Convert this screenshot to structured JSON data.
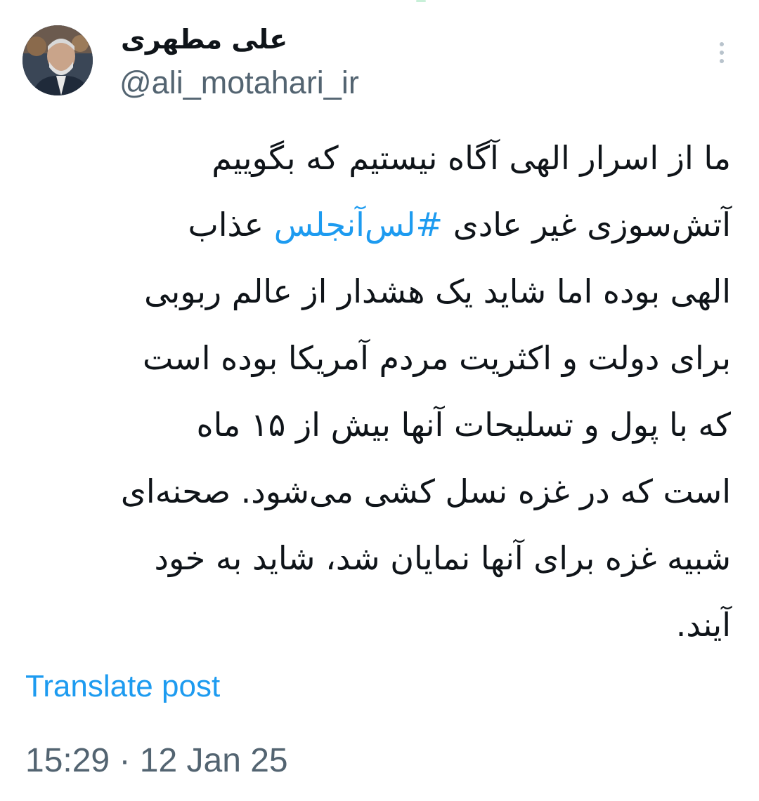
{
  "author": {
    "display_name": "علی مطهری",
    "handle": "@ali_motahari_ir"
  },
  "post": {
    "lines": [
      {
        "before": "ما از اسرار الهی آگاه نیستیم که بگوییم",
        "hashtag": "",
        "after": ""
      },
      {
        "before": "آتش‌سوزی غیر عادی ",
        "hashtag": "#لس‌آنجلس",
        "after": " عذاب"
      },
      {
        "before": "الهی بوده اما شاید یک هشدار از عالم ربوبی",
        "hashtag": "",
        "after": ""
      },
      {
        "before": "برای دولت و اکثریت مردم آمریکا بوده است",
        "hashtag": "",
        "after": ""
      },
      {
        "before": "که با پول و تسلیحات آنها بیش از ۱۵ ماه",
        "hashtag": "",
        "after": ""
      },
      {
        "before": "است که در غزه نسل کشی می‌شود. صحنه‌ای",
        "hashtag": "",
        "after": ""
      },
      {
        "before": "شبیه غزه برای  آنها نمایان شد، شاید به خود",
        "hashtag": "",
        "after": ""
      },
      {
        "before": "آیند.",
        "hashtag": "",
        "after": ""
      }
    ]
  },
  "actions": {
    "translate_label": "Translate post"
  },
  "meta": {
    "timestamp": "15:29 · 12 Jan 25"
  },
  "icons": {
    "more": "more-vertical-icon",
    "avatar": "avatar"
  },
  "colors": {
    "link": "#1d9bf0",
    "secondary_text": "#536471",
    "primary_text": "#0f1419"
  }
}
